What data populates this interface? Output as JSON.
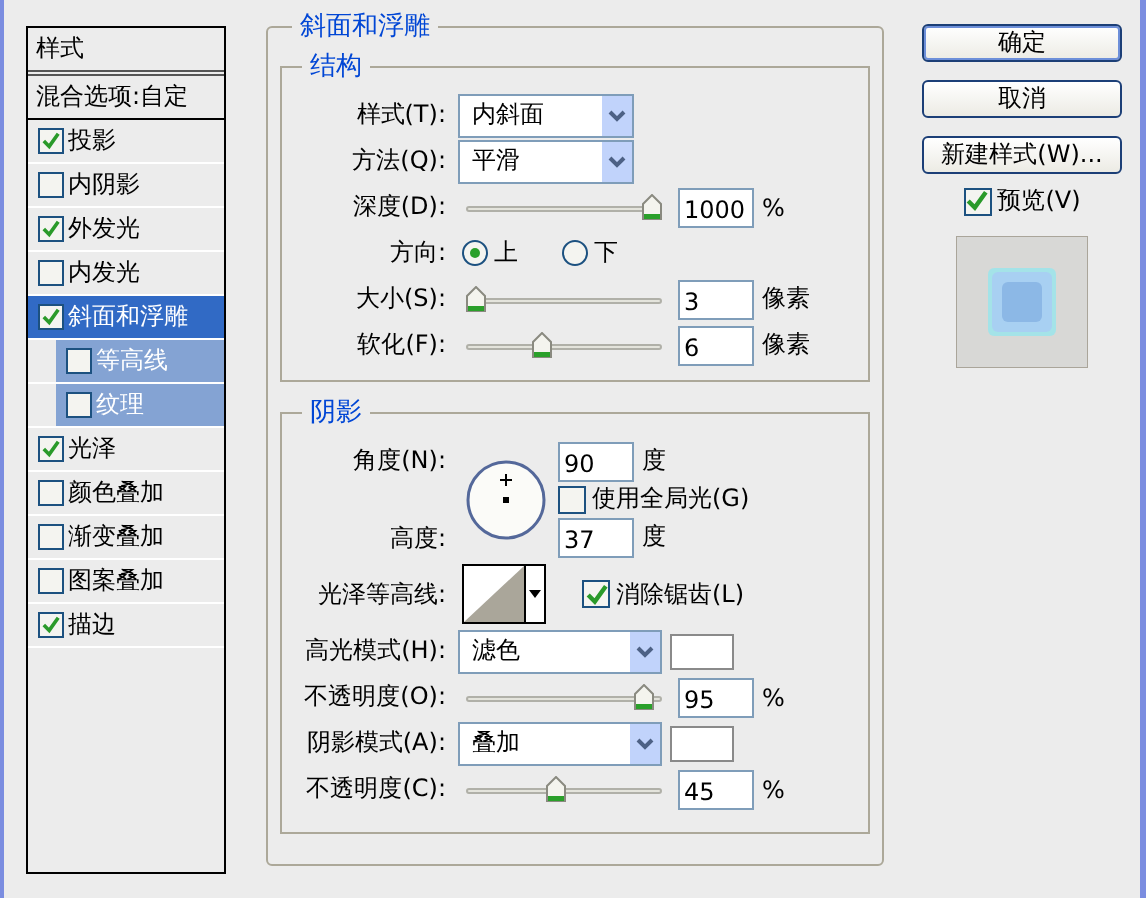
{
  "style_list": {
    "header": "样式",
    "blend_options": "混合选项:自定",
    "items": [
      {
        "label": "投影",
        "checked": true,
        "selected": false
      },
      {
        "label": "内阴影",
        "checked": false,
        "selected": false
      },
      {
        "label": "外发光",
        "checked": true,
        "selected": false
      },
      {
        "label": "内发光",
        "checked": false,
        "selected": false
      },
      {
        "label": "斜面和浮雕",
        "checked": true,
        "selected": true,
        "children": [
          {
            "label": "等高线",
            "checked": false,
            "selected": false
          },
          {
            "label": "纹理",
            "checked": false,
            "selected": false
          }
        ]
      },
      {
        "label": "光泽",
        "checked": true,
        "selected": false
      },
      {
        "label": "颜色叠加",
        "checked": false,
        "selected": false
      },
      {
        "label": "渐变叠加",
        "checked": false,
        "selected": false
      },
      {
        "label": "图案叠加",
        "checked": false,
        "selected": false
      },
      {
        "label": "描边",
        "checked": true,
        "selected": false
      }
    ]
  },
  "panel": {
    "title": "斜面和浮雕",
    "structure": {
      "title": "结构",
      "rows": [
        {
          "kind": "select",
          "label": "样式(T):",
          "value": "内斜面"
        },
        {
          "kind": "select",
          "label": "方法(Q):",
          "value": "平滑"
        },
        {
          "kind": "slider",
          "label": "深度(D):",
          "level": 1,
          "value": "1000",
          "unit": "%"
        },
        {
          "kind": "radio",
          "label": "方向:",
          "options": [
            {
              "label": "上",
              "selected": true
            },
            {
              "label": "下",
              "selected": false
            }
          ]
        },
        {
          "kind": "slider",
          "label": "大小(S):",
          "level": 0,
          "value": "3",
          "unit": "像素"
        },
        {
          "kind": "slider",
          "label": "软化(F):",
          "level": 0.38,
          "value": "6",
          "unit": "像素"
        }
      ]
    },
    "shading": {
      "title": "阴影",
      "angle": {
        "label": "角度(N):",
        "value": "90",
        "unit": "度"
      },
      "global_light": {
        "label": "使用全局光(G)",
        "checked": false
      },
      "altitude": {
        "label": "高度:",
        "value": "37",
        "unit": "度"
      },
      "gloss_contour": {
        "label": "光泽等高线:"
      },
      "anti_aliased": {
        "label": "消除锯齿(L)",
        "checked": true
      },
      "rows": [
        {
          "kind": "select",
          "label": "高光模式(H):",
          "value": "滤色"
        },
        {
          "kind": "slider",
          "label": "不透明度(O):",
          "level": 0.95,
          "value": "95",
          "unit": "%"
        },
        {
          "kind": "select",
          "label": "阴影模式(A):",
          "value": "叠加"
        },
        {
          "kind": "slider",
          "label": "不透明度(C):",
          "level": 0.45,
          "value": "45",
          "unit": "%"
        }
      ]
    }
  },
  "buttons": [
    {
      "label": "确定",
      "default": true
    },
    {
      "label": "取消",
      "default": false
    },
    {
      "label": "新建样式(W)...",
      "default": false
    }
  ],
  "preview": {
    "label": "预览(V)",
    "checked": true
  }
}
